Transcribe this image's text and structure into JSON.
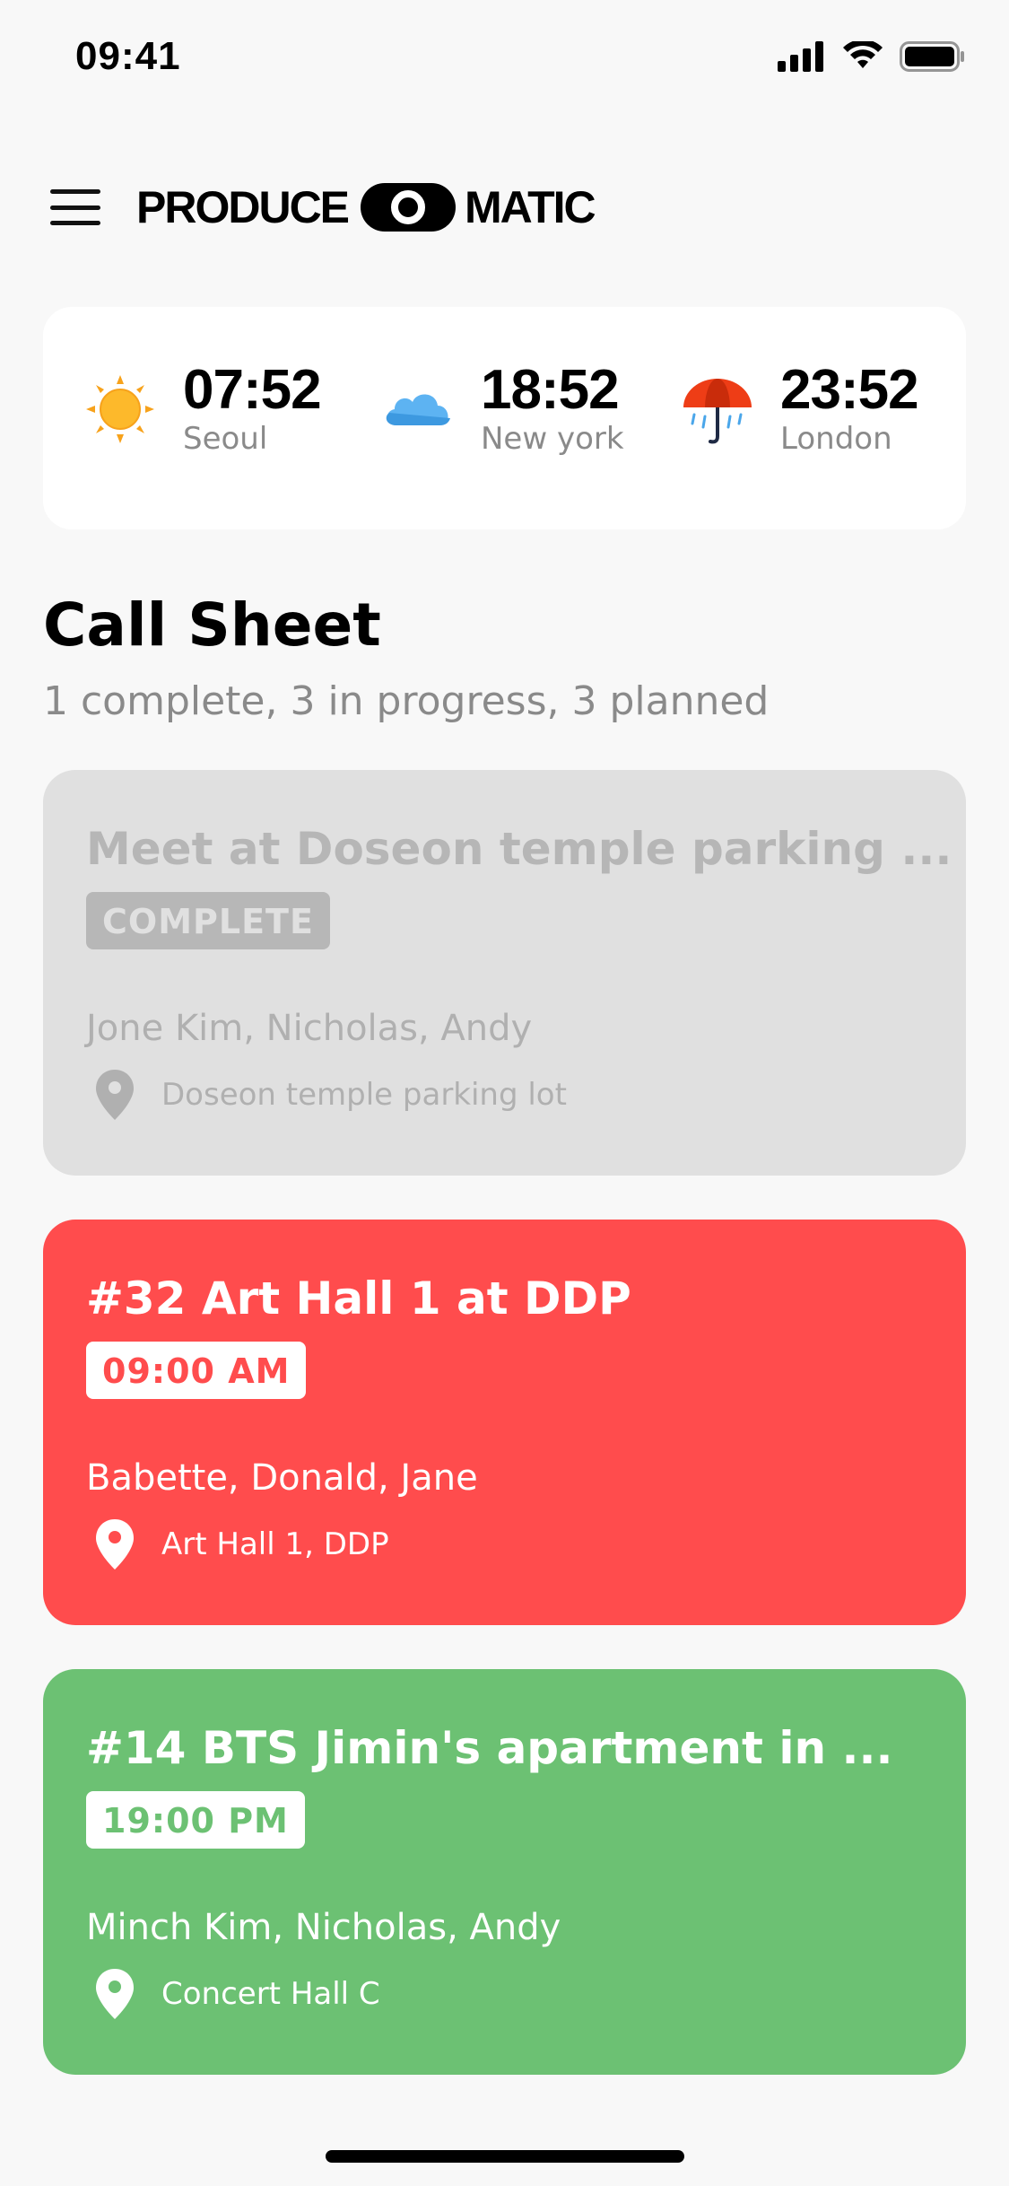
{
  "status_bar": {
    "time": "09:41"
  },
  "header": {
    "logo_left": "PRODUCE",
    "logo_right": "MATIC"
  },
  "weather": [
    {
      "time": "07:52",
      "city": "Seoul",
      "icon": "sun-icon"
    },
    {
      "time": "18:52",
      "city": "New york",
      "icon": "cloud-icon"
    },
    {
      "time": "23:52",
      "city": "London",
      "icon": "umbrella-icon"
    }
  ],
  "call_sheet": {
    "title": "Call Sheet",
    "summary": "1 complete, 3 in progress, 3 planned",
    "items": [
      {
        "title": "Meet at Doseon temple parking ...",
        "badge": "COMPLETE",
        "people": "Jone Kim, Nicholas, Andy",
        "location": "Doseon temple parking lot",
        "color": "#e0e0e0"
      },
      {
        "title": "#32 Art Hall 1 at DDP",
        "badge": "09:00 AM",
        "people": "Babette, Donald, Jane",
        "location": "Art Hall 1, DDP",
        "color": "#ff4c4d"
      },
      {
        "title": "#14 BTS Jimin's apartment in ...",
        "badge": "19:00 PM",
        "people": "Minch Kim, Nicholas, Andy",
        "location": "Concert Hall C",
        "color": "#6cc173"
      }
    ]
  }
}
